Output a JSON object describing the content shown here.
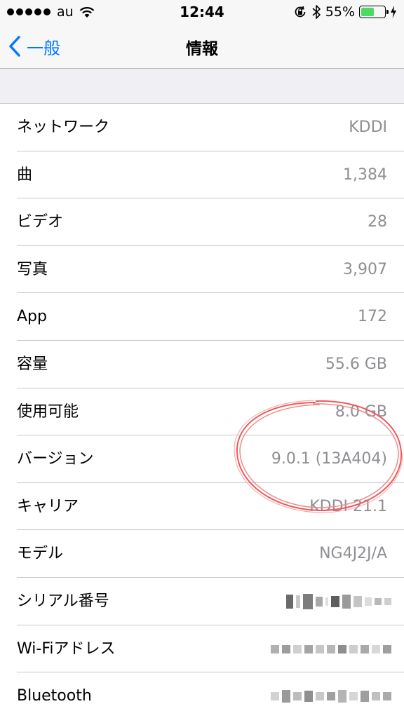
{
  "status_bar": {
    "carrier": "au",
    "time": "12:44",
    "battery_percent": "55%",
    "battery_level": 0.55,
    "icons": [
      "signal-dots",
      "wifi-icon",
      "rotation-lock-icon",
      "bluetooth-icon",
      "battery-icon",
      "charging-bolt-icon"
    ]
  },
  "nav": {
    "back_label": "一般",
    "title": "情報"
  },
  "rows": [
    {
      "label": "ネットワーク",
      "value": "KDDI"
    },
    {
      "label": "曲",
      "value": "1,384"
    },
    {
      "label": "ビデオ",
      "value": "28"
    },
    {
      "label": "写真",
      "value": "3,907"
    },
    {
      "label": "App",
      "value": "172"
    },
    {
      "label": "容量",
      "value": "55.6 GB"
    },
    {
      "label": "使用可能",
      "value": "8.0 GB"
    },
    {
      "label": "バージョン",
      "value": "9.0.1 (13A404)"
    },
    {
      "label": "キャリア",
      "value": "KDDI 21.1"
    },
    {
      "label": "モデル",
      "value": "NG4J2J/A"
    },
    {
      "label": "シリアル番号",
      "value": ""
    },
    {
      "label": "Wi-Fiアドレス",
      "value": ""
    },
    {
      "label": "Bluetooth",
      "value": ""
    }
  ],
  "colors": {
    "accent": "#007aff",
    "value_gray": "#8e8e93",
    "annotation_red": "#ee5a5a",
    "battery_green": "#4cd964"
  }
}
